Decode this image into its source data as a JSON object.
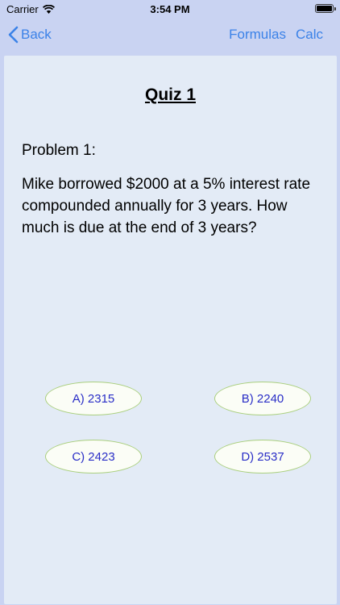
{
  "status_bar": {
    "carrier": "Carrier",
    "time": "3:54 PM"
  },
  "nav": {
    "back_label": "Back",
    "formulas_label": "Formulas",
    "calc_label": "Calc",
    "accent_color": "#3b82e8"
  },
  "quiz": {
    "title": "Quiz 1",
    "problem_label": "Problem 1:",
    "problem_text": "Mike borrowed $2000 at a 5% interest rate compounded annually for 3 years. How much is due at the end of 3 years?",
    "answers": [
      {
        "label": "A) 2315"
      },
      {
        "label": "B) 2240"
      },
      {
        "label": "C) 2423"
      },
      {
        "label": "D) 2537"
      }
    ]
  }
}
